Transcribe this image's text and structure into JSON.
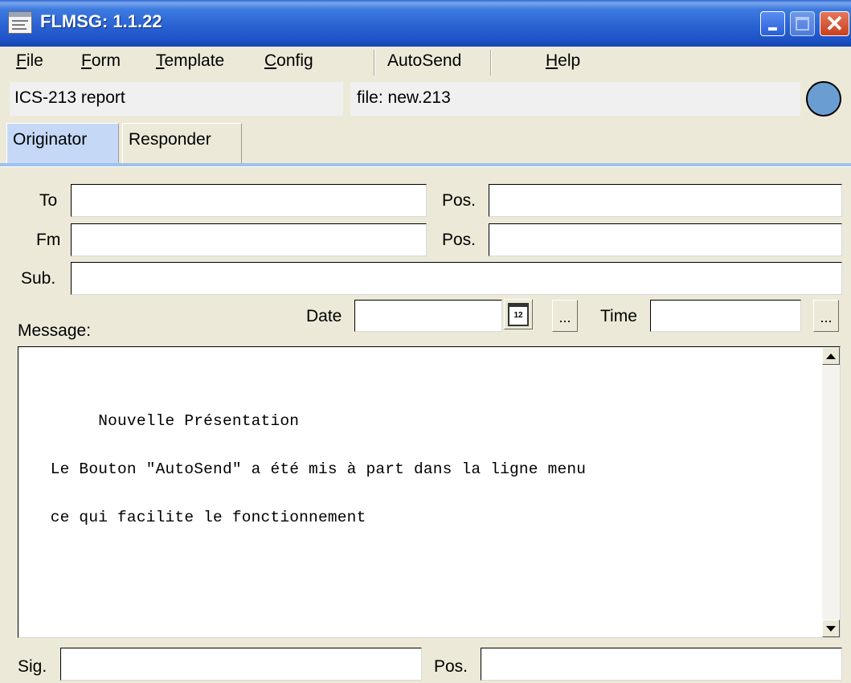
{
  "window": {
    "title": "FLMSG: 1.1.22",
    "close_glyph": "✕"
  },
  "menu": {
    "file": "ile",
    "file_mnemonic": "F",
    "form": "orm",
    "form_mnemonic": "F",
    "template": "emplate",
    "template_mnemonic": "T",
    "config": "onfig",
    "config_mnemonic": "C",
    "autosend": "AutoSend",
    "help": "elp",
    "help_mnemonic": "H"
  },
  "info": {
    "form_type": "ICS-213 report",
    "file": "file: new.213"
  },
  "tabs": [
    {
      "label": "Originator",
      "active": true
    },
    {
      "label": "Responder",
      "active": false
    }
  ],
  "form": {
    "to_label": "To",
    "to_value": "",
    "to_pos_label": "Pos.",
    "to_pos_value": "",
    "fm_label": "Fm",
    "fm_value": "",
    "fm_pos_label": "Pos.",
    "fm_pos_value": "",
    "sub_label": "Sub.",
    "sub_value": "",
    "date_label": "Date",
    "date_value": "",
    "calendar_day": "12",
    "date_more": "...",
    "time_label": "Time",
    "time_value": "",
    "time_more": "...",
    "message_label": "Message:",
    "message_text": "\n        Nouvelle Présentation\n   Le Bouton \"AutoSend\" a été mis à part dans la ligne menu\n   ce qui facilite le fonctionnement",
    "sig_label": "Sig.",
    "sig_value": "",
    "sig_pos_label": "Pos.",
    "sig_pos_value": ""
  },
  "icons": {
    "app": "flmsg-app-icon",
    "status": "status-indicator-circle",
    "calendar": "calendar-icon"
  },
  "colors": {
    "titlebar": "#2b63d3",
    "window_bg": "#ece9d8",
    "active_tab": "#c5d9f7",
    "status_indicator": "#6a9ed3"
  }
}
